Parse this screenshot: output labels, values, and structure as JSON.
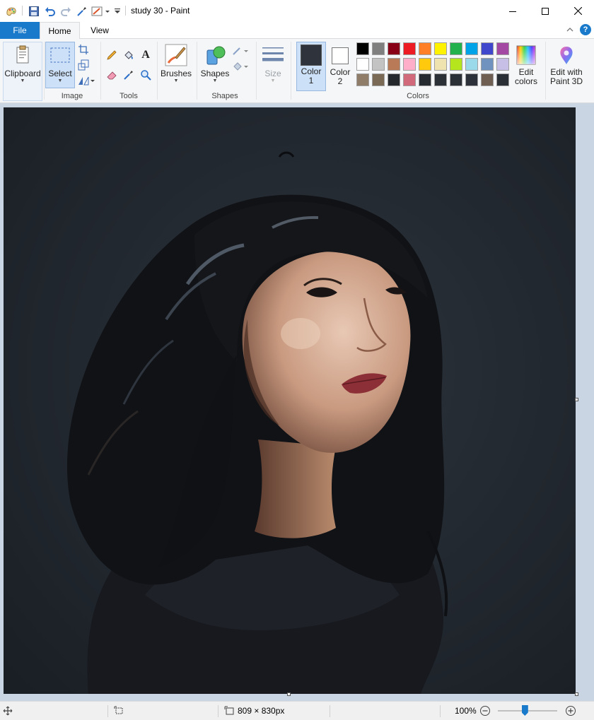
{
  "window": {
    "title": "study 30 - Paint"
  },
  "tabs": {
    "file": "File",
    "home": "Home",
    "view": "View",
    "help": "?"
  },
  "ribbon": {
    "clipboard": {
      "label": "Clipboard"
    },
    "image": {
      "group_label": "Image",
      "select": "Select"
    },
    "tools": {
      "group_label": "Tools"
    },
    "brushes": {
      "label": "Brushes"
    },
    "shapes": {
      "label": "Shapes",
      "group_label": "Shapes"
    },
    "size": {
      "label": "Size"
    },
    "colors": {
      "group_label": "Colors",
      "color1_line1": "Color",
      "color1_line2": "1",
      "color2_line1": "Color",
      "color2_line2": "2",
      "edit_colors_line1": "Edit",
      "edit_colors_line2": "colors",
      "color1_value": "#2f333b",
      "color2_value": "#ffffff",
      "palette": [
        "#000000",
        "#7f7f7f",
        "#880015",
        "#ed1c24",
        "#ff7f27",
        "#fff200",
        "#22b14c",
        "#00a2e8",
        "#3f48cc",
        "#a349a4",
        "#ffffff",
        "#c3c3c3",
        "#b97a57",
        "#ffaec9",
        "#ffc90e",
        "#efe4b0",
        "#b5e61d",
        "#99d9ea",
        "#7092be",
        "#c8bfe7",
        "#8f7c69",
        "#7a6a55",
        "#25282d",
        "#d16a7a",
        "#262a31",
        "#2c3037",
        "#2b2f36",
        "#2d3139",
        "#6f5f52",
        "#2a2e35"
      ]
    },
    "paint3d": {
      "line1": "Edit with",
      "line2": "Paint 3D"
    }
  },
  "status": {
    "image_size": "809 × 830px",
    "zoom": "100%",
    "zoom_fraction": 0.45
  }
}
